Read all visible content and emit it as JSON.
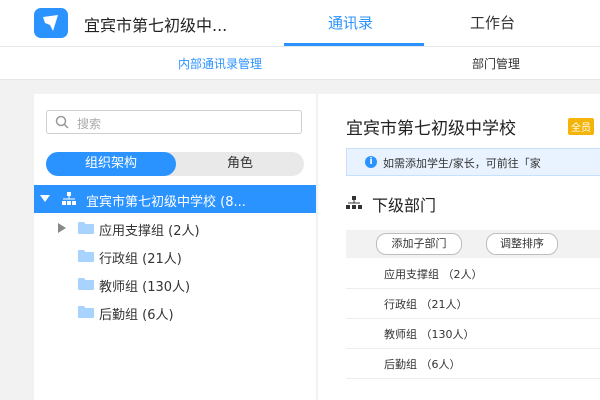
{
  "header": {
    "org_name": "宜宾市第七初级中...",
    "tabs": [
      {
        "label": "通讯录",
        "active": true
      },
      {
        "label": "工作台",
        "active": false
      }
    ]
  },
  "subnav": {
    "items": [
      {
        "label": "内部通讯录管理",
        "active": true
      },
      {
        "label": "部门管理",
        "active": false
      }
    ]
  },
  "left": {
    "search_placeholder": "搜索",
    "segments": {
      "org": "组织架构",
      "role": "角色"
    },
    "tree_root": "宜宾市第七初级中学校 (8...",
    "tree_children": [
      {
        "label": "应用支撑组 (2人)",
        "expandable": true
      },
      {
        "label": "行政组 (21人)",
        "expandable": false
      },
      {
        "label": "教师组 (130人)",
        "expandable": false
      },
      {
        "label": "后勤组 (6人)",
        "expandable": false
      }
    ]
  },
  "right": {
    "school_title": "宜宾市第七初级中学校",
    "badge": "全员",
    "notice": "如需添加学生/家长，可前往「家",
    "sub_heading": "下级部门",
    "add_sub_dept": "添加子部门",
    "adjust_order": "调整排序",
    "departments": [
      "应用支撑组 （2人）",
      "行政组 （21人）",
      "教师组 （130人）",
      "后勤组 （6人）"
    ]
  },
  "colors": {
    "accent": "#2b93ff",
    "badge": "#f5b40a",
    "notice_bg": "#e8f3ff"
  }
}
